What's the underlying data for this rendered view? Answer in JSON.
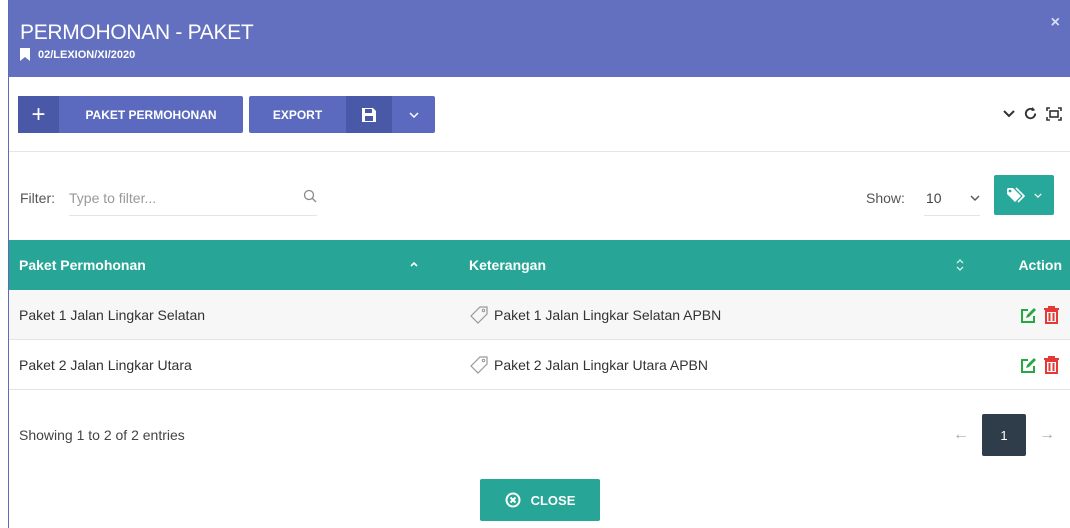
{
  "header": {
    "title": "PERMOHONAN - PAKET",
    "subtitle": "02/LEXION/XI/2020",
    "close_symbol": "×",
    "bookmark_icon": "bookmark-icon"
  },
  "toolbar": {
    "add_symbol": "+",
    "paket_label": "PAKET PERMOHONAN",
    "export_label": "EXPORT",
    "save_icon": "floppy-disk-icon",
    "icons": [
      "chevron-down-icon",
      "refresh-icon",
      "fullscreen-icon"
    ]
  },
  "filter": {
    "label": "Filter:",
    "placeholder": "Type to filter...",
    "value": ""
  },
  "show": {
    "label": "Show:",
    "value": "10"
  },
  "table": {
    "columns": [
      "Paket Permohonan",
      "Keterangan",
      "Action"
    ],
    "rows": [
      {
        "paket": "Paket 1 Jalan Lingkar Selatan",
        "keterangan": "Paket 1 Jalan Lingkar Selatan APBN"
      },
      {
        "paket": "Paket 2 Jalan Lingkar Utara",
        "keterangan": "Paket 2 Jalan Lingkar Utara APBN"
      }
    ]
  },
  "footer": {
    "info": "Showing 1 to 2 of 2 entries",
    "prev": "←",
    "page": "1",
    "next": "→"
  },
  "close_button": {
    "label": "CLOSE"
  },
  "colors": {
    "header": "#6370c0",
    "primary_button": "#5b6abf",
    "teal": "#27a596",
    "edit": "#28a745",
    "delete": "#e53935",
    "page_active": "#2f3d4a"
  }
}
